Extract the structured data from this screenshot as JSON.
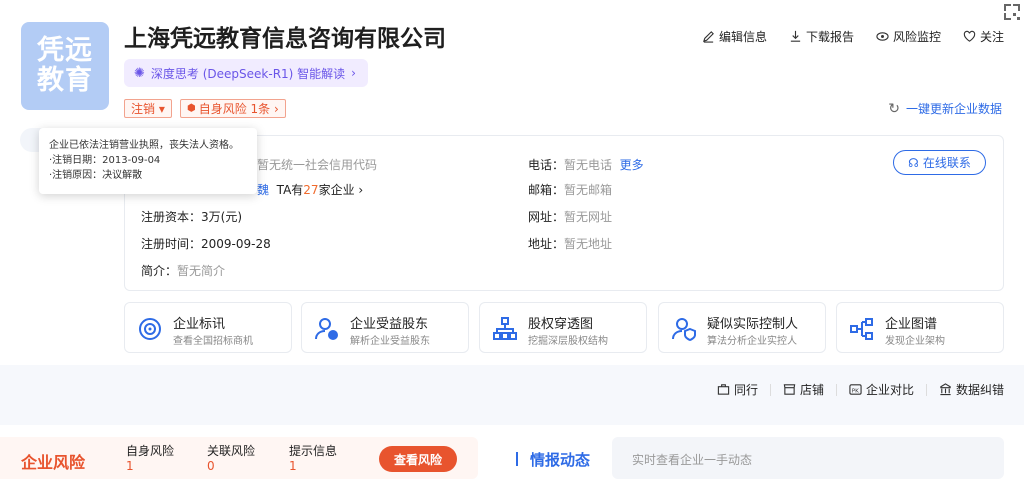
{
  "logo": {
    "line1": "凭远",
    "line2": "教育"
  },
  "company": {
    "name": "上海凭远教育信息咨询有限公司",
    "ai_label": "深度思考 (DeepSeek-R1) 智能解读",
    "status_tag": "注销 ▾",
    "risk_tag": "自身风险 1条 ›"
  },
  "header_actions": [
    {
      "label": "编辑信息",
      "icon": "edit-icon"
    },
    {
      "label": "下载报告",
      "icon": "download-icon"
    },
    {
      "label": "风险监控",
      "icon": "eye-icon"
    },
    {
      "label": "关注",
      "icon": "heart-icon"
    }
  ],
  "refresh_label": "一键更新企业数据",
  "tooltip": {
    "line1": "企业已依法注销营业执照，丧失法人资格。",
    "line2": "·注销日期：2013-09-04",
    "line3": "·注销原因：决议解散"
  },
  "info": {
    "credit_code_value": "暂无统一社会信用代码",
    "legal_person_fragment": "魏",
    "ta_prefix": "TA有",
    "ta_count": "27",
    "ta_suffix": "家企业 ›",
    "capital_label": "注册资本：",
    "capital_value": "3万(元)",
    "date_label": "注册时间：",
    "date_value": "2009-09-28",
    "intro_label": "简介：",
    "intro_value": "暂无简介",
    "phone_label": "电话：",
    "phone_value": "暂无电话",
    "phone_more": "更多",
    "email_label": "邮箱：",
    "email_value": "暂无邮箱",
    "website_label": "网址：",
    "website_value": "暂无网址",
    "address_label": "地址：",
    "address_value": "暂无地址",
    "online_button": "在线联系"
  },
  "features": [
    {
      "title": "企业标讯",
      "subtitle": "查看全国招标商机",
      "icon": "target-icon"
    },
    {
      "title": "企业受益股东",
      "subtitle": "解析企业受益股东",
      "icon": "beneficiary-icon"
    },
    {
      "title": "股权穿透图",
      "subtitle": "挖掘深层股权结构",
      "icon": "equity-tree-icon"
    },
    {
      "title": "疑似实际控制人",
      "subtitle": "算法分析企业实控人",
      "icon": "controller-icon"
    },
    {
      "title": "企业图谱",
      "subtitle": "发现企业架构",
      "icon": "graph-icon"
    }
  ],
  "tools": [
    {
      "label": "同行",
      "icon": "briefcase-icon"
    },
    {
      "label": "店铺",
      "icon": "shop-icon"
    },
    {
      "label": "企业对比",
      "icon": "pk-icon"
    },
    {
      "label": "数据纠错",
      "icon": "correction-icon"
    }
  ],
  "risk": {
    "title": "企业风险",
    "self_label": "自身风险",
    "self_value": "1",
    "related_label": "关联风险",
    "related_value": "0",
    "hint_label": "提示信息",
    "hint_value": "1",
    "button": "查看风险"
  },
  "intel": {
    "title": "情报动态",
    "placeholder": "实时查看企业一手动态"
  },
  "colors": {
    "brand_blue": "#2e6be6",
    "risk_orange": "#e8542e",
    "ai_purple": "#6a55e8"
  }
}
